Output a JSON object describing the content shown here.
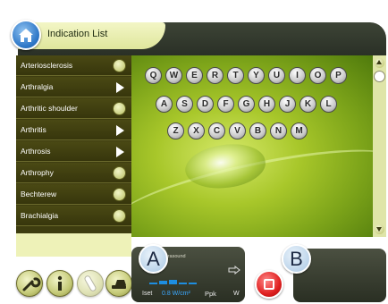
{
  "header": {
    "title": "Indication List",
    "home_icon": "home-icon"
  },
  "sidebar": {
    "items": [
      {
        "label": "Arteriosclerosis",
        "icon": "circle-leaf-icon"
      },
      {
        "label": "Arthralgia",
        "icon": "arrow-right-icon"
      },
      {
        "label": "Arthritic shoulder",
        "icon": "circle-leaf-icon"
      },
      {
        "label": "Arthritis",
        "icon": "arrow-right-icon"
      },
      {
        "label": "Arthrosis",
        "icon": "arrow-right-icon"
      },
      {
        "label": "Arthrophy",
        "icon": "circle-leaf-icon"
      },
      {
        "label": "Bechterew",
        "icon": "circle-leaf-icon"
      },
      {
        "label": "Brachialgia",
        "icon": "circle-leaf-icon"
      }
    ]
  },
  "keyboard": {
    "row1": [
      "Q",
      "W",
      "E",
      "R",
      "T",
      "Y",
      "U",
      "I",
      "O",
      "P"
    ],
    "row2": [
      "A",
      "S",
      "D",
      "F",
      "G",
      "H",
      "J",
      "K",
      "L"
    ],
    "row3": [
      "Z",
      "X",
      "C",
      "V",
      "B",
      "N",
      "M"
    ]
  },
  "toolbar": {
    "tools": [
      "wrench-icon",
      "info-icon",
      "bandage-icon",
      "applicator-icon"
    ]
  },
  "panel_a": {
    "badge": "A",
    "mode": "Ultrasound",
    "iset_label": "Iset",
    "intensity": "0.8 W/cm²",
    "ppk_label": "Ppk",
    "watt_unit": "W"
  },
  "panel_b": {
    "badge": "B"
  },
  "colors": {
    "accent_blue": "#2f78c8",
    "sidebar_bg": "#3e3d10",
    "header_tab": "#e6ecb0",
    "stop_red": "#e02020",
    "intensity_text": "#3aa8ff"
  }
}
